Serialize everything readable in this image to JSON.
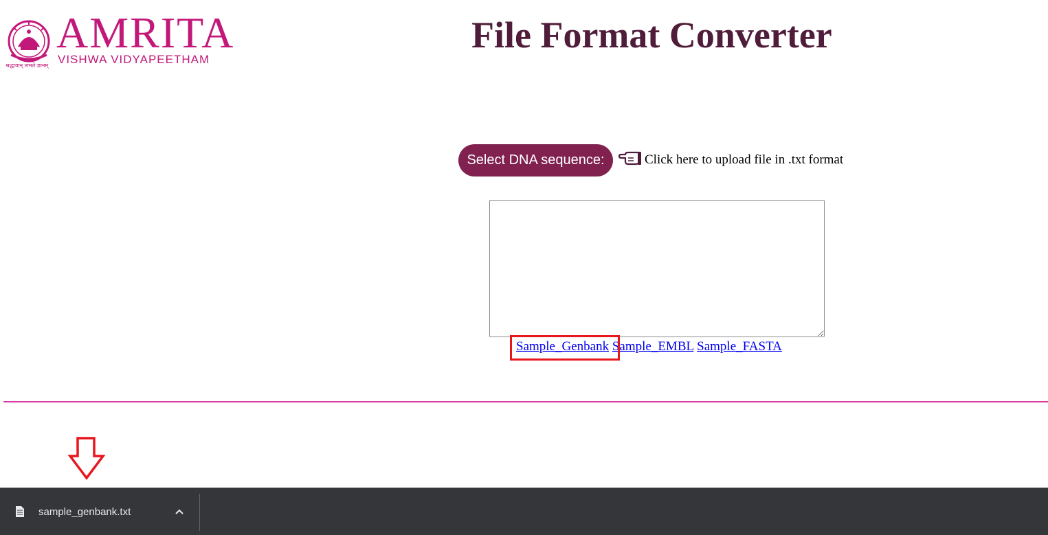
{
  "logo": {
    "name": "AMRITA",
    "subtitle": "VISHWA VIDYAPEETHAM",
    "motto": "श्रद्धावान् लभते ज्ञानम्"
  },
  "header": {
    "title": "File Format Converter"
  },
  "upload": {
    "select_button_label": "Select DNA sequence:",
    "hint_text": "Click here to upload file in .txt format",
    "hint_icon": "pointing-hand-icon"
  },
  "sequence_input": {
    "value": "",
    "placeholder": ""
  },
  "samples": {
    "genbank": "Sample_Genbank",
    "embl": "Sample_EMBL",
    "fasta": "Sample_FASTA"
  },
  "download_bar": {
    "file_name": "sample_genbank.txt",
    "file_icon": "document-icon",
    "expand_icon": "chevron-up-icon"
  },
  "colors": {
    "brand": "#c2187a",
    "title": "#4f1c3a",
    "button": "#80214f",
    "divider": "#d63a9e",
    "annotation": "#e8171e",
    "download_bar": "#35363a"
  }
}
